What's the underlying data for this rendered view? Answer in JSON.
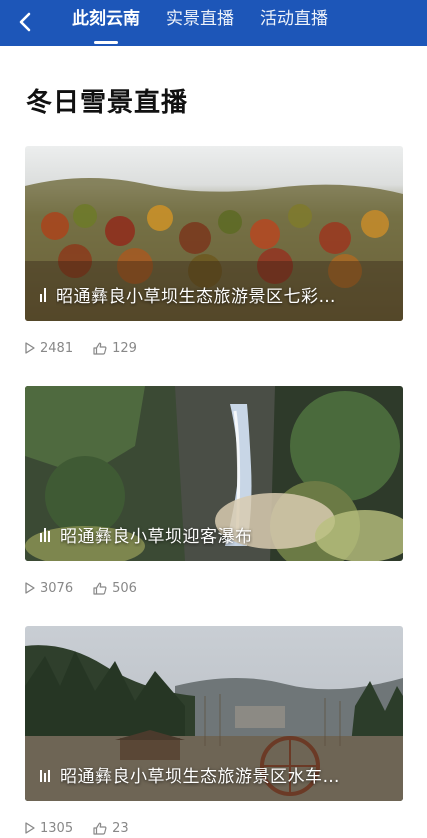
{
  "header": {
    "tabs": [
      {
        "label": "此刻云南",
        "active": true
      },
      {
        "label": "实景直播",
        "active": false
      },
      {
        "label": "活动直播",
        "active": false
      }
    ],
    "bar_color": "#1d56b8"
  },
  "section_title": "冬日雪景直播",
  "videos": [
    {
      "title": "昭通彝良小草坝生态旅游景区七彩…",
      "plays": "2481",
      "likes": "129"
    },
    {
      "title": "昭通彝良小草坝迎客瀑布",
      "plays": "3076",
      "likes": "506"
    },
    {
      "title": "昭通彝良小草坝生态旅游景区水车…",
      "plays": "1305",
      "likes": "23"
    }
  ],
  "icons": [
    "back-arrow-icon",
    "live-bars-icon",
    "play-icon",
    "thumbs-up-icon"
  ]
}
